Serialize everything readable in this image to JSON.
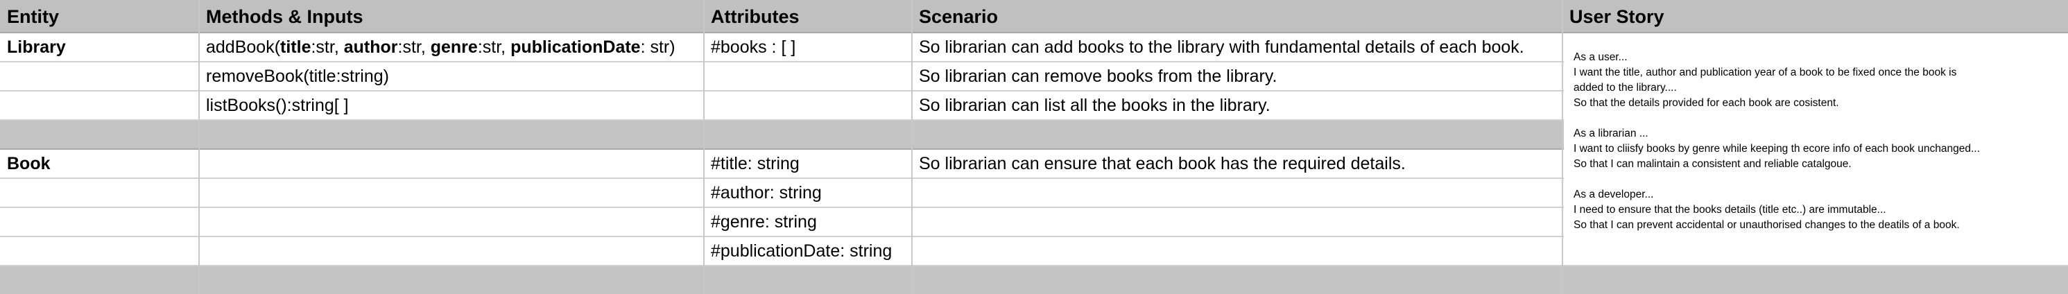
{
  "headers": [
    "Entity",
    "Methods & Inputs",
    "Attributes",
    "Scenario",
    "User Story"
  ],
  "rows": [
    {
      "entity": "Library",
      "method_parts": [
        {
          "text": "addBook(",
          "bold": false
        },
        {
          "text": "title",
          "bold": true
        },
        {
          "text": ":str, ",
          "bold": false
        },
        {
          "text": "author",
          "bold": true
        },
        {
          "text": ":str, ",
          "bold": false
        },
        {
          "text": "genre",
          "bold": true
        },
        {
          "text": ":str, ",
          "bold": false
        },
        {
          "text": "publicationDate",
          "bold": true
        },
        {
          "text": ": str)",
          "bold": false
        }
      ],
      "attribute": "#books : [ ]",
      "scenario": "So librarian can add books to the library with fundamental details of each book."
    },
    {
      "entity": "",
      "method": "removeBook(title:string)",
      "attribute": "",
      "scenario": "So librarian can remove books from the library."
    },
    {
      "entity": "",
      "method": "listBooks():string[ ]",
      "attribute": "",
      "scenario": "So librarian can list all the books in the library."
    },
    {
      "entity": "Book",
      "method": "",
      "attribute": "#title: string",
      "scenario": "So librarian can ensure that each book has the required details."
    },
    {
      "entity": "",
      "method": "",
      "attribute": "#author: string",
      "scenario": ""
    },
    {
      "entity": "",
      "method": "",
      "attribute": "#genre: string",
      "scenario": ""
    },
    {
      "entity": "",
      "method": "",
      "attribute": "#publicationDate: string",
      "scenario": ""
    }
  ],
  "user_stories": [
    {
      "lines": [
        "As a user...",
        "I want the title, author and publication year of a book to be fixed once the book is",
        "added to the library....",
        "So that the details provided for each book  are cosistent."
      ]
    },
    {
      "lines": [
        "As a librarian ...",
        "I want to cliisfy books by genre while keeping th ecore info of each book unchanged...",
        "So that I can malintain a consistent and reliable catalgoue."
      ]
    },
    {
      "lines": [
        "As a developer...",
        "I need to ensure that the books details (title etc..) are immutable...",
        "So that I can prevent accidental or unauthorised changes to the deatils of a book."
      ]
    }
  ]
}
